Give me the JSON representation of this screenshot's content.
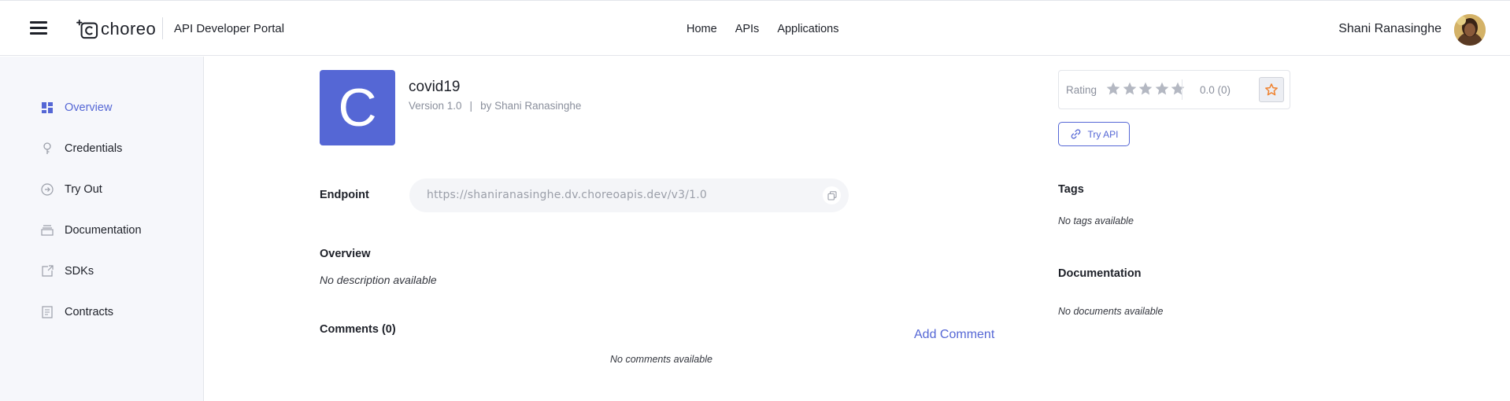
{
  "header": {
    "logo_text": "choreo",
    "portal_title": "API Developer Portal",
    "nav": [
      "Home",
      "APIs",
      "Applications"
    ],
    "user_name": "Shani Ranasinghe"
  },
  "sidebar": {
    "items": [
      {
        "label": "Overview",
        "icon": "overview-icon",
        "active": true
      },
      {
        "label": "Credentials",
        "icon": "key-icon",
        "active": false
      },
      {
        "label": "Try Out",
        "icon": "arrow-circle-icon",
        "active": false
      },
      {
        "label": "Documentation",
        "icon": "stack-icon",
        "active": false
      },
      {
        "label": "SDKs",
        "icon": "export-icon",
        "active": false
      },
      {
        "label": "Contracts",
        "icon": "document-icon",
        "active": false
      }
    ]
  },
  "api": {
    "initial": "C",
    "name": "covid19",
    "version": "Version 1.0",
    "separator": "|",
    "by": "by Shani Ranasinghe"
  },
  "endpoint": {
    "label": "Endpoint",
    "url": "https://shaniranasinghe.dv.choreoapis.dev/v3/1.0"
  },
  "overview": {
    "title": "Overview",
    "text": "No description available"
  },
  "comments": {
    "title": "Comments (0)",
    "add_label": "Add Comment",
    "empty_text": "No comments available"
  },
  "rating": {
    "label": "Rating",
    "value_text": "0.0 (0)",
    "stars": 5,
    "filled": 0
  },
  "try_api": {
    "label": "Try API"
  },
  "tags": {
    "title": "Tags",
    "empty_text": "No tags available"
  },
  "documentation": {
    "title": "Documentation",
    "empty_text": "No documents available"
  },
  "colors": {
    "accent": "#5567d5",
    "star_empty": "#b4b8c2",
    "favorite_star": "#f0822e"
  }
}
